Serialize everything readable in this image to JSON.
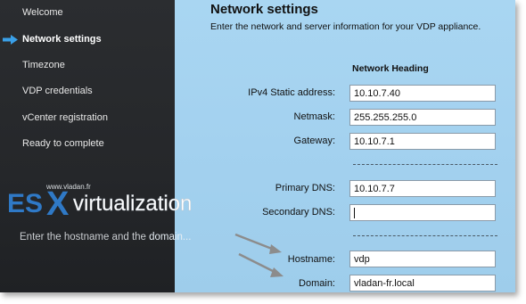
{
  "sidebar": {
    "items": [
      {
        "label": "Welcome"
      },
      {
        "label": "Network settings"
      },
      {
        "label": "Timezone"
      },
      {
        "label": "VDP credentials"
      },
      {
        "label": "vCenter registration"
      },
      {
        "label": "Ready to complete"
      }
    ]
  },
  "main": {
    "title": "Network settings",
    "subtitle": "Enter the network and server information for your VDP appliance.",
    "section_heading": "Network Heading",
    "fields": {
      "ipv4": {
        "label": "IPv4 Static address:",
        "value": "10.10.7.40"
      },
      "netmask": {
        "label": "Netmask:",
        "value": "255.255.255.0"
      },
      "gateway": {
        "label": "Gateway:",
        "value": "10.10.7.1"
      },
      "primary_dns": {
        "label": "Primary DNS:",
        "value": "10.10.7.7"
      },
      "secondary_dns": {
        "label": "Secondary DNS:",
        "value": ""
      },
      "hostname": {
        "label": "Hostname:",
        "value": "vdp"
      },
      "domain": {
        "label": "Domain:",
        "value": "vladan-fr.local"
      }
    }
  },
  "watermark": {
    "url": "www.vladan.fr",
    "brand_left": "ES",
    "brand_x": "X",
    "brand_right": "virtualization"
  },
  "overlay": {
    "hint_part1": "Enter the hostname and the ",
    "hint_part2": "domain...",
    "arrow_color": "#8c8c8c"
  },
  "colors": {
    "sidebar_bg": "#26282b",
    "main_bg": "#a6d3f0",
    "active_arrow": "#3aa0e8",
    "logo_blue": "#2f79c6"
  },
  "icons": {
    "active_indicator": "arrow-right-icon"
  }
}
